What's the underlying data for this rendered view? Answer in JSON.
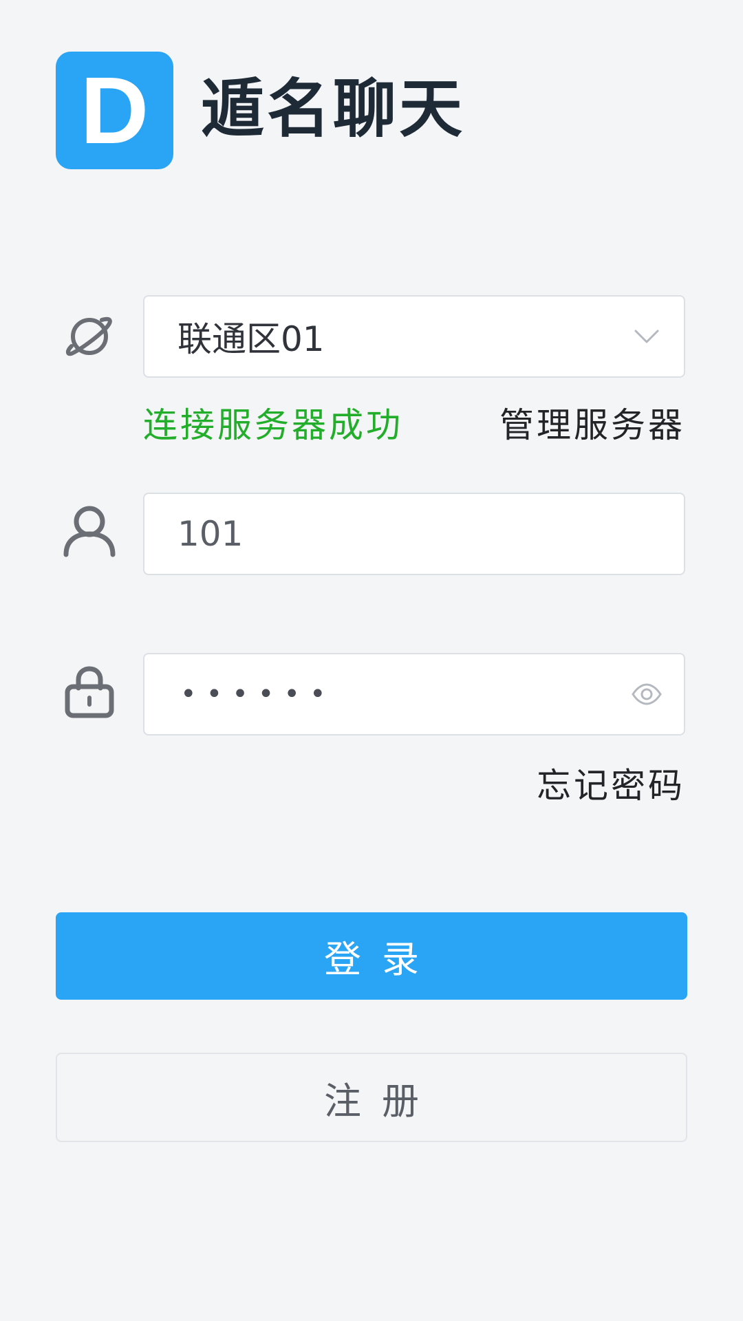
{
  "header": {
    "logo_letter": "D",
    "app_title": "遁名聊天"
  },
  "server": {
    "selected_value": "联通区01",
    "status_text": "连接服务器成功",
    "manage_link": "管理服务器",
    "icon": "planet-icon"
  },
  "username": {
    "value": "101",
    "icon": "user-icon"
  },
  "password": {
    "masked_value": "••••••",
    "icon": "lock-icon",
    "toggle_icon": "eye-icon",
    "forgot_link": "忘记密码"
  },
  "buttons": {
    "login_label": "登录",
    "register_label": "注册"
  },
  "colors": {
    "accent": "#2aa4f4",
    "success": "#22ad2b",
    "background": "#f4f5f7",
    "title": "#1f2a37"
  }
}
